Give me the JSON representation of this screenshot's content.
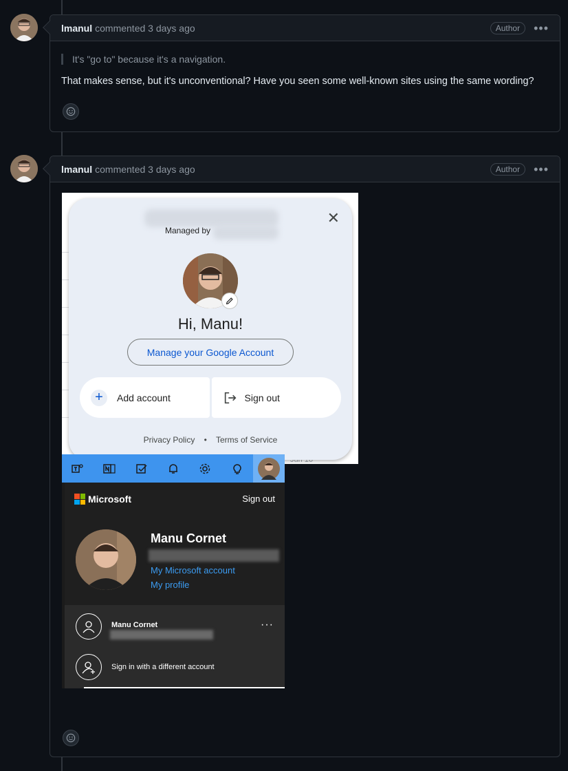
{
  "comments": [
    {
      "author": "lmanul",
      "meta": "commented 3 days ago",
      "badge": "Author",
      "quote": "It's \"go to\" because it's a navigation.",
      "text": "That makes sense, but it's unconventional? Have you seen some well-known sites using the same wording?"
    },
    {
      "author": "lmanul",
      "meta": "commented 3 days ago",
      "badge": "Author"
    }
  ],
  "google_card": {
    "managed_by": "Managed by",
    "greeting": "Hi, Manu!",
    "manage_button": "Manage your Google Account",
    "add_account": "Add account",
    "sign_out": "Sign out",
    "privacy": "Privacy Policy",
    "separator": "•",
    "terms": "Terms of Service",
    "background_date": "Jun 16"
  },
  "ms_card": {
    "brand": "Microsoft",
    "sign_out": "Sign out",
    "name": "Manu Cornet",
    "my_account": "My Microsoft account",
    "my_profile": "My profile",
    "account_name": "Manu Cornet",
    "more": "···",
    "different_account": "Sign in with a different account",
    "toolbar_icons": [
      "teams-icon",
      "onenote-icon",
      "todo-icon",
      "bell-icon",
      "gear-icon",
      "lightbulb-icon",
      "avatar"
    ],
    "brand_colors": [
      "#f25022",
      "#7fba00",
      "#00a4ef",
      "#ffb900"
    ]
  },
  "colors": {
    "background": "#0d1117",
    "header": "#161b22",
    "border": "#30363d",
    "google_link": "#0b57d0",
    "ms_bar": "#3e94ee",
    "ms_link": "#3c9cf2"
  }
}
